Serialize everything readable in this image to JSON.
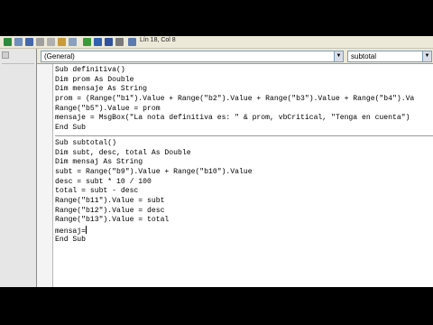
{
  "toolbar": {
    "position": "Lín 18, Col 8"
  },
  "combos": {
    "object": "(General)",
    "procedure": "subtotal"
  },
  "code": {
    "proc1": [
      "Sub definitiva()",
      "Dim prom As Double",
      "Dim mensaje As String",
      "prom = (Range(\"b1\").Value + Range(\"b2\").Value + Range(\"b3\").Value + Range(\"b4\").Va",
      "Range(\"b5\").Value = prom",
      "mensaje = MsgBox(\"La nota definitiva es: \" & prom, vbCritical, \"Tenga en cuenta\")",
      "End Sub"
    ],
    "proc2": [
      "Sub subtotal()",
      "Dim subt, desc, total As Double",
      "Dim mensaj As String",
      "subt = Range(\"b9\").Value + Range(\"b10\").Value",
      "desc = subt * 10 / 100",
      "total = subt - desc",
      "Range(\"b11\").Value = subt",
      "Range(\"b12\").Value = desc",
      "Range(\"b13\").Value = total",
      "mensaj=",
      "End Sub"
    ]
  },
  "colors": {
    "toolbar": "#ece9d8",
    "editor": "#ffffff"
  }
}
